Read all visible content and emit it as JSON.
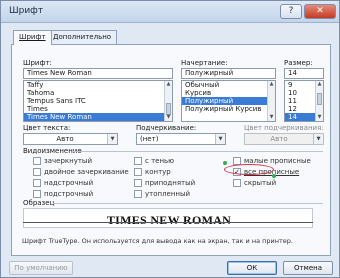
{
  "window": {
    "title": "Шрифт",
    "help": "?",
    "close": "✕"
  },
  "tabs": [
    {
      "label": "Шрифт"
    },
    {
      "label": "Дополнительно"
    }
  ],
  "font": {
    "label": "Шрифт:",
    "value": "Times New Roman",
    "items": [
      "Taffy",
      "Tahoma",
      "Tempus Sans ITC",
      "Times",
      "Times New Roman"
    ],
    "selected_index": 4
  },
  "style": {
    "label": "Начертание:",
    "value": "Полужирный",
    "items": [
      "Обычный",
      "Курсив",
      "Полужирный",
      "Полужирный Курсив"
    ],
    "selected_index": 2
  },
  "size": {
    "label": "Размер:",
    "value": "14",
    "items": [
      "9",
      "10",
      "11",
      "12",
      "14"
    ],
    "selected_index": 4
  },
  "text_color": {
    "label": "Цвет текста:",
    "value": "Авто"
  },
  "underline": {
    "label": "Подчеркивание:",
    "value": "(нет)"
  },
  "underline_color": {
    "label": "Цвет подчеркивания:",
    "value": "Авто"
  },
  "effects": {
    "label": "Видоизменение",
    "items": [
      {
        "label": "зачеркнутый",
        "checked": false
      },
      {
        "label": "двойное зачеркивание",
        "checked": false
      },
      {
        "label": "надстрочный",
        "checked": false
      },
      {
        "label": "подстрочный",
        "checked": false
      },
      {
        "label": "с тенью",
        "checked": false
      },
      {
        "label": "контур",
        "checked": false
      },
      {
        "label": "приподнятый",
        "checked": false
      },
      {
        "label": "утопленный",
        "checked": false
      },
      {
        "label": "малые прописные",
        "checked": false
      },
      {
        "label": "все прописные",
        "checked": true
      },
      {
        "label": "скрытый",
        "checked": false
      }
    ]
  },
  "sample": {
    "label": "Образец",
    "text": "TIMES NEW ROMAN",
    "description": "Шрифт TrueType. Он используется для вывода как на экран, так и на принтер."
  },
  "buttons": {
    "default": "По умолчанию",
    "ok": "ОК",
    "cancel": "Отмена"
  },
  "colors": {
    "selection": "#3a7bd5",
    "annotation": "#d43b4c",
    "marker": "#2fb04a"
  }
}
